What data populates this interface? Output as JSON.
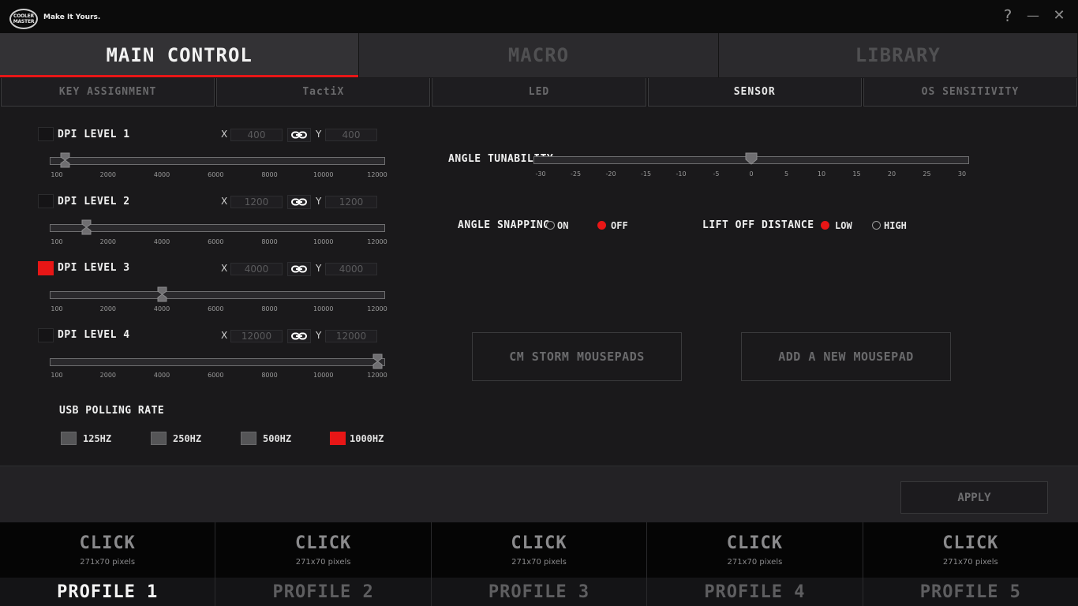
{
  "app": {
    "logo_line1": "COOLER",
    "logo_line2": "MASTER",
    "tagline": "Make It Yours."
  },
  "window_controls": {
    "help": "?",
    "minimize": "—",
    "close": "✕"
  },
  "main_tabs": [
    {
      "label": "MAIN CONTROL",
      "active": true
    },
    {
      "label": "MACRO",
      "active": false
    },
    {
      "label": "LIBRARY",
      "active": false
    }
  ],
  "sub_tabs": [
    {
      "label": "KEY ASSIGNMENT",
      "active": false
    },
    {
      "label": "TactiX",
      "active": false
    },
    {
      "label": "LED",
      "active": false
    },
    {
      "label": "SENSOR",
      "active": true
    },
    {
      "label": "OS SENSITIVITY",
      "active": false
    }
  ],
  "dpi_levels": [
    {
      "label": "DPI LEVEL 1",
      "enabled": false,
      "x_label": "X",
      "y_label": "Y",
      "x": "400",
      "y": "400",
      "value": 400
    },
    {
      "label": "DPI LEVEL 2",
      "enabled": false,
      "x_label": "X",
      "y_label": "Y",
      "x": "1200",
      "y": "1200",
      "value": 1200
    },
    {
      "label": "DPI LEVEL 3",
      "enabled": true,
      "x_label": "X",
      "y_label": "Y",
      "x": "4000",
      "y": "4000",
      "value": 4000
    },
    {
      "label": "DPI LEVEL 4",
      "enabled": false,
      "x_label": "X",
      "y_label": "Y",
      "x": "12000",
      "y": "12000",
      "value": 12000
    }
  ],
  "dpi_ticks": [
    "100",
    "2000",
    "4000",
    "6000",
    "8000",
    "10000",
    "12000"
  ],
  "dpi_range": [
    100,
    12000
  ],
  "usb_polling": {
    "title": "USB POLLING RATE",
    "options": [
      {
        "label": "125HZ",
        "selected": false
      },
      {
        "label": "250HZ",
        "selected": false
      },
      {
        "label": "500HZ",
        "selected": false
      },
      {
        "label": "1000HZ",
        "selected": true
      }
    ]
  },
  "angle_tunability": {
    "label": "ANGLE TUNABILITY",
    "value": 0,
    "range": [
      -30,
      30
    ],
    "ticks": [
      "-30",
      "-25",
      "-20",
      "-15",
      "-10",
      "-5",
      "0",
      "5",
      "10",
      "15",
      "20",
      "25",
      "30"
    ]
  },
  "angle_snapping": {
    "label": "ANGLE SNAPPING",
    "options": [
      {
        "label": "ON",
        "selected": false
      },
      {
        "label": "OFF",
        "selected": true
      }
    ]
  },
  "lift_off_distance": {
    "label": "LIFT OFF DISTANCE",
    "options": [
      {
        "label": "LOW",
        "selected": true
      },
      {
        "label": "HIGH",
        "selected": false
      }
    ]
  },
  "mousepad_buttons": {
    "cm_storm": "CM STORM MOUSEPADS",
    "add_new": "ADD A NEW MOUSEPAD"
  },
  "apply_label": "APPLY",
  "profiles": [
    {
      "image_text": "CLICK",
      "image_size": "271x70 pixels",
      "name": "PROFILE 1",
      "active": true
    },
    {
      "image_text": "CLICK",
      "image_size": "271x70 pixels",
      "name": "PROFILE 2",
      "active": false
    },
    {
      "image_text": "CLICK",
      "image_size": "271x70 pixels",
      "name": "PROFILE 3",
      "active": false
    },
    {
      "image_text": "CLICK",
      "image_size": "271x70 pixels",
      "name": "PROFILE 4",
      "active": false
    },
    {
      "image_text": "CLICK",
      "image_size": "271x70 pixels",
      "name": "PROFILE 5",
      "active": false
    }
  ],
  "colors": {
    "accent": "#e81616",
    "background": "#1a191b"
  }
}
